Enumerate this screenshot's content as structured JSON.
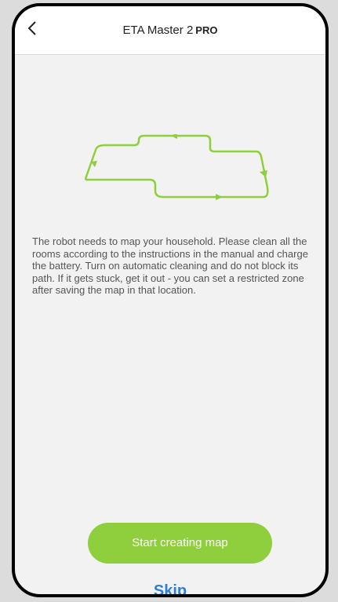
{
  "header": {
    "back_icon": "chevron-left-icon",
    "title": "ETA Master 2",
    "title_badge": "PRO"
  },
  "illustration": {
    "icon": "cleaning-path-icon",
    "stroke_color": "#8fce3c"
  },
  "main": {
    "description": "The robot needs to map your household. Please clean all the rooms according to the instructions in the manual and charge the battery. Turn on automatic cleaning and do not block its path. If it gets stuck, get it out - you can set a restricted zone after saving the map in that location."
  },
  "actions": {
    "start_label": "Start creating map",
    "skip_label": "Skip"
  },
  "colors": {
    "accent_green": "#8fce3c",
    "link_blue": "#2e7fd6"
  }
}
